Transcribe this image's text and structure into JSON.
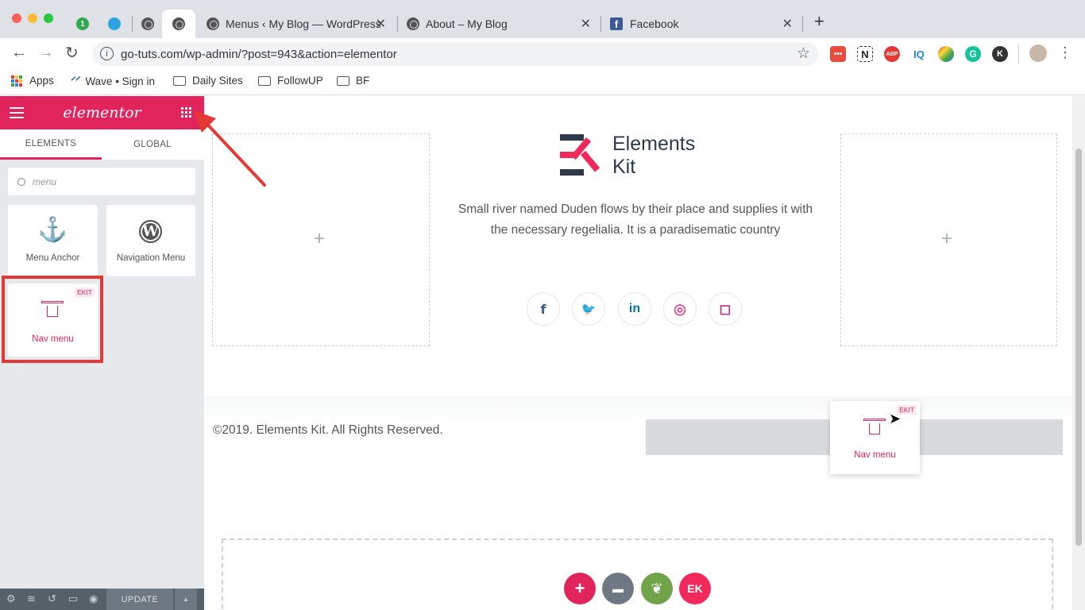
{
  "browser": {
    "tabs": [
      {
        "title": "1"
      },
      {
        "title": ""
      },
      {
        "title": ""
      },
      {
        "title": ""
      },
      {
        "title": "Menus ‹ My Blog — WordPress",
        "close": "✕"
      },
      {
        "title": "About – My Blog",
        "close": "✕"
      },
      {
        "title": "Facebook",
        "close": "✕"
      }
    ],
    "new_tab": "+",
    "url": "go-tuts.com/wp-admin/?post=943&action=elementor",
    "bookmarks": [
      {
        "label": "Apps"
      },
      {
        "label": "Wave • Sign in"
      },
      {
        "label": "Daily Sites"
      },
      {
        "label": "FollowUP"
      },
      {
        "label": "BF"
      }
    ],
    "extensions": [
      "•••",
      "N",
      "ABP",
      "IQ",
      "",
      "G",
      "K"
    ],
    "colors": {
      "tabstrip": "#dee1e6",
      "omnibox": "#f1f3f4"
    }
  },
  "elementor": {
    "logo": "elementor",
    "tabs": {
      "elements": "ELEMENTS",
      "global": "GLOBAL"
    },
    "search": {
      "value": "menu"
    },
    "widgets": [
      {
        "label": "Menu Anchor",
        "icon": "anchor-icon"
      },
      {
        "label": "Navigation Menu",
        "icon": "wordpress-icon"
      },
      {
        "label": "Nav menu",
        "icon": "nav-menu-icon",
        "badge": "EKIT"
      }
    ],
    "footer": {
      "update": "UPDATE"
    },
    "colors": {
      "brand": "#e2245c",
      "panel_bg": "#e6e9ec",
      "footer": "#556068"
    }
  },
  "canvas": {
    "logo": {
      "line1": "Elements",
      "line2": "Kit",
      "mark": "EK"
    },
    "description": "Small river named Duden flows by their place and supplies it with the necessary regelialia. It is a paradisematic country",
    "social": [
      {
        "icon": "facebook-icon",
        "glyph": "f",
        "color": "#3b5998"
      },
      {
        "icon": "twitter-icon",
        "glyph": "🐦",
        "color": "#1da1f2"
      },
      {
        "icon": "linkedin-icon",
        "glyph": "in",
        "color": "#0077b5"
      },
      {
        "icon": "dribbble-icon",
        "glyph": "◎",
        "color": "#ea4c89"
      },
      {
        "icon": "instagram-icon",
        "glyph": "◻",
        "color": "#c13584"
      }
    ],
    "plus": "+",
    "copyright": "©2019. Elements Kit. All Rights Reserved.",
    "drag_widget": {
      "label": "Nav menu",
      "badge": "EKIT"
    },
    "fabs": [
      {
        "icon": "add-icon",
        "glyph": "+",
        "color": "#e2245c"
      },
      {
        "icon": "folder-icon",
        "glyph": "▬",
        "color": "#6d7882"
      },
      {
        "icon": "leaf-icon",
        "glyph": "❦",
        "color": "#71a34a"
      },
      {
        "icon": "elementskit-icon",
        "glyph": "EK",
        "color": "#f2295b"
      }
    ]
  }
}
